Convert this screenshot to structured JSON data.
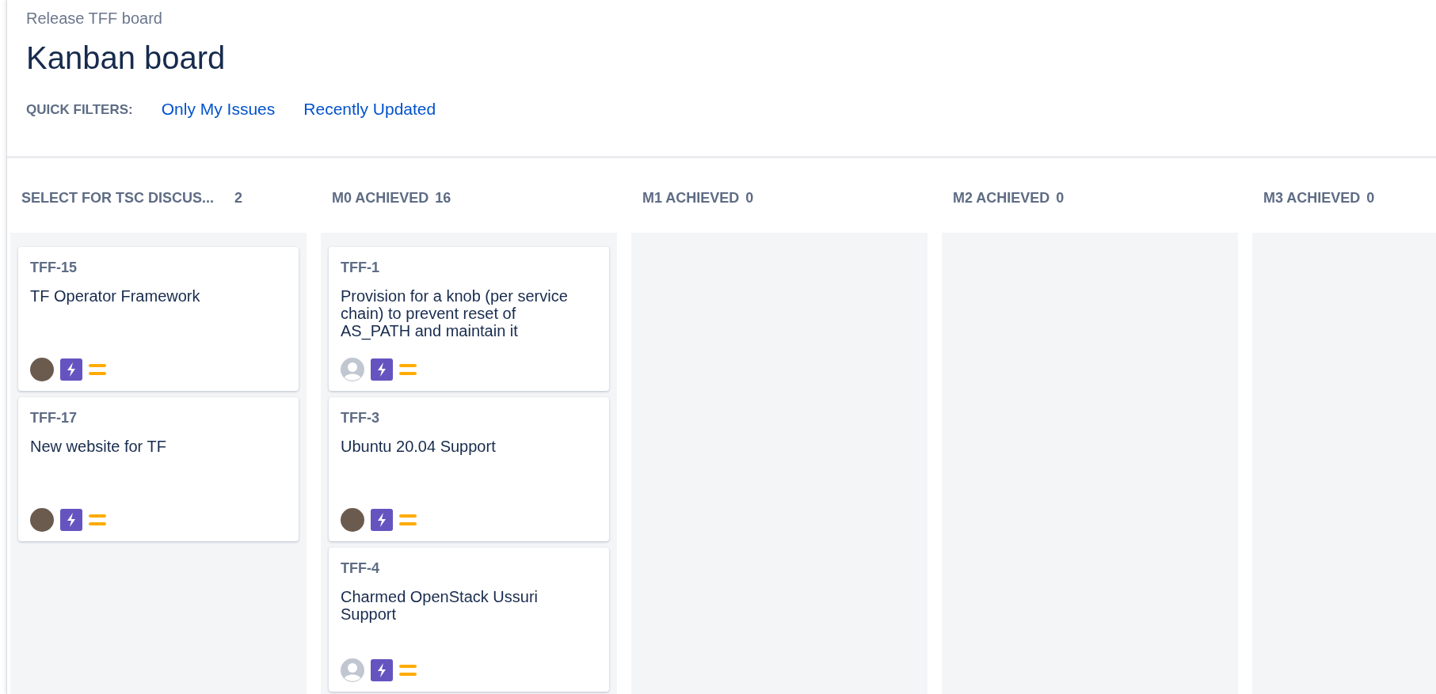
{
  "breadcrumb": "Release TFF board",
  "title": "Kanban board",
  "quick_filters": {
    "label": "QUICK FILTERS:",
    "filters": [
      {
        "label": "Only My Issues",
        "selected": false
      },
      {
        "label": "Recently Updated",
        "selected": false
      }
    ]
  },
  "columns": [
    {
      "name": "SELECT FOR TSC DISCUS...",
      "count": "2",
      "cards": [
        {
          "key": "TFF-15",
          "summary": "TF Operator Framework",
          "kind": "photo"
        },
        {
          "key": "TFF-17",
          "summary": "New website for TF",
          "kind": "photo"
        }
      ]
    },
    {
      "name": "M0 ACHIEVED",
      "count": "16",
      "cards": [
        {
          "key": "TFF-1",
          "summary": "Provision for a knob (per service chain) to prevent reset of AS_PATH and maintain it",
          "kind": "default"
        },
        {
          "key": "TFF-3",
          "summary": "Ubuntu 20.04 Support",
          "kind": "photo"
        },
        {
          "key": "TFF-4",
          "summary": "Charmed OpenStack Ussuri Support",
          "kind": "default"
        }
      ]
    },
    {
      "name": "M1 ACHIEVED",
      "count": "0"
    },
    {
      "name": "M2 ACHIEVED",
      "count": "0"
    },
    {
      "name": "M3 ACHIEVED",
      "count": "0"
    }
  ]
}
